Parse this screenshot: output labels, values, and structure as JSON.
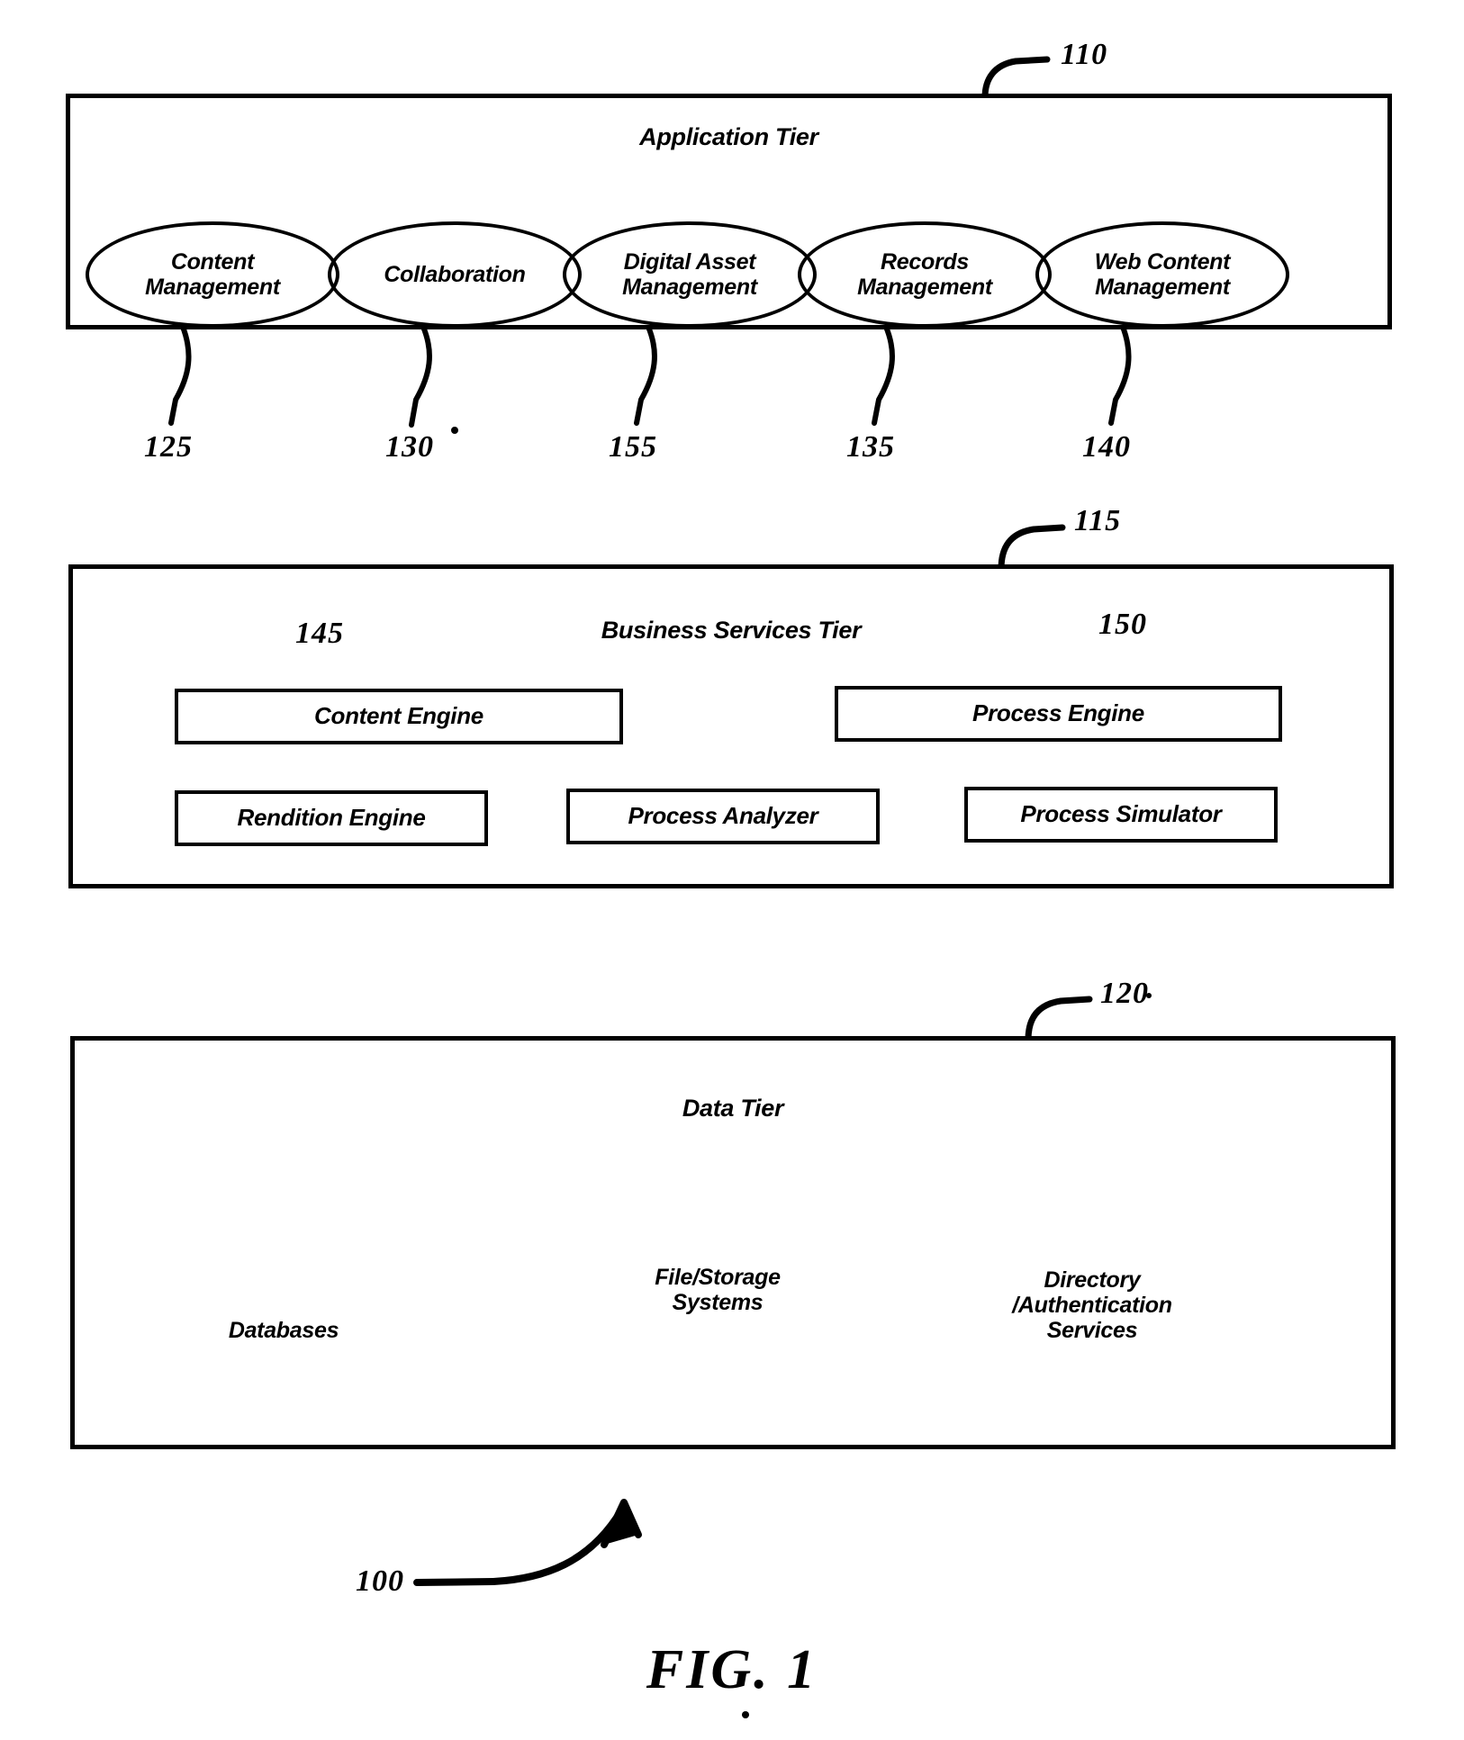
{
  "figure": {
    "caption": "FIG. 1",
    "system_ref": "100"
  },
  "tiers": [
    {
      "id": "application-tier",
      "title": "Application Tier",
      "ref": "110",
      "nodes": [
        {
          "label": "Content\nManagement",
          "ref": "125"
        },
        {
          "label": "Collaboration",
          "ref": "130"
        },
        {
          "label": "Digital Asset\nManagement",
          "ref": "155"
        },
        {
          "label": "Records\nManagement",
          "ref": "135"
        },
        {
          "label": "Web Content\nManagement",
          "ref": "140"
        }
      ]
    },
    {
      "id": "business-services-tier",
      "title": "Business Services Tier",
      "ref": "115",
      "nodes": [
        {
          "label": "Content Engine",
          "ref": "145"
        },
        {
          "label": "Process Engine",
          "ref": "150"
        },
        {
          "label": "Rendition Engine",
          "ref": ""
        },
        {
          "label": "Process Analyzer",
          "ref": ""
        },
        {
          "label": "Process Simulator",
          "ref": ""
        }
      ]
    },
    {
      "id": "data-tier",
      "title": "Data Tier",
      "ref": "120",
      "nodes": [
        {
          "label": "Databases",
          "ref": "",
          "shape": "cylinder-stack"
        },
        {
          "label": "File/Storage\nSystems",
          "ref": "",
          "shape": "rect-stack"
        },
        {
          "label": "Directory\n/Authentication\nServices",
          "ref": "",
          "shape": "triangle-stack"
        }
      ]
    }
  ]
}
